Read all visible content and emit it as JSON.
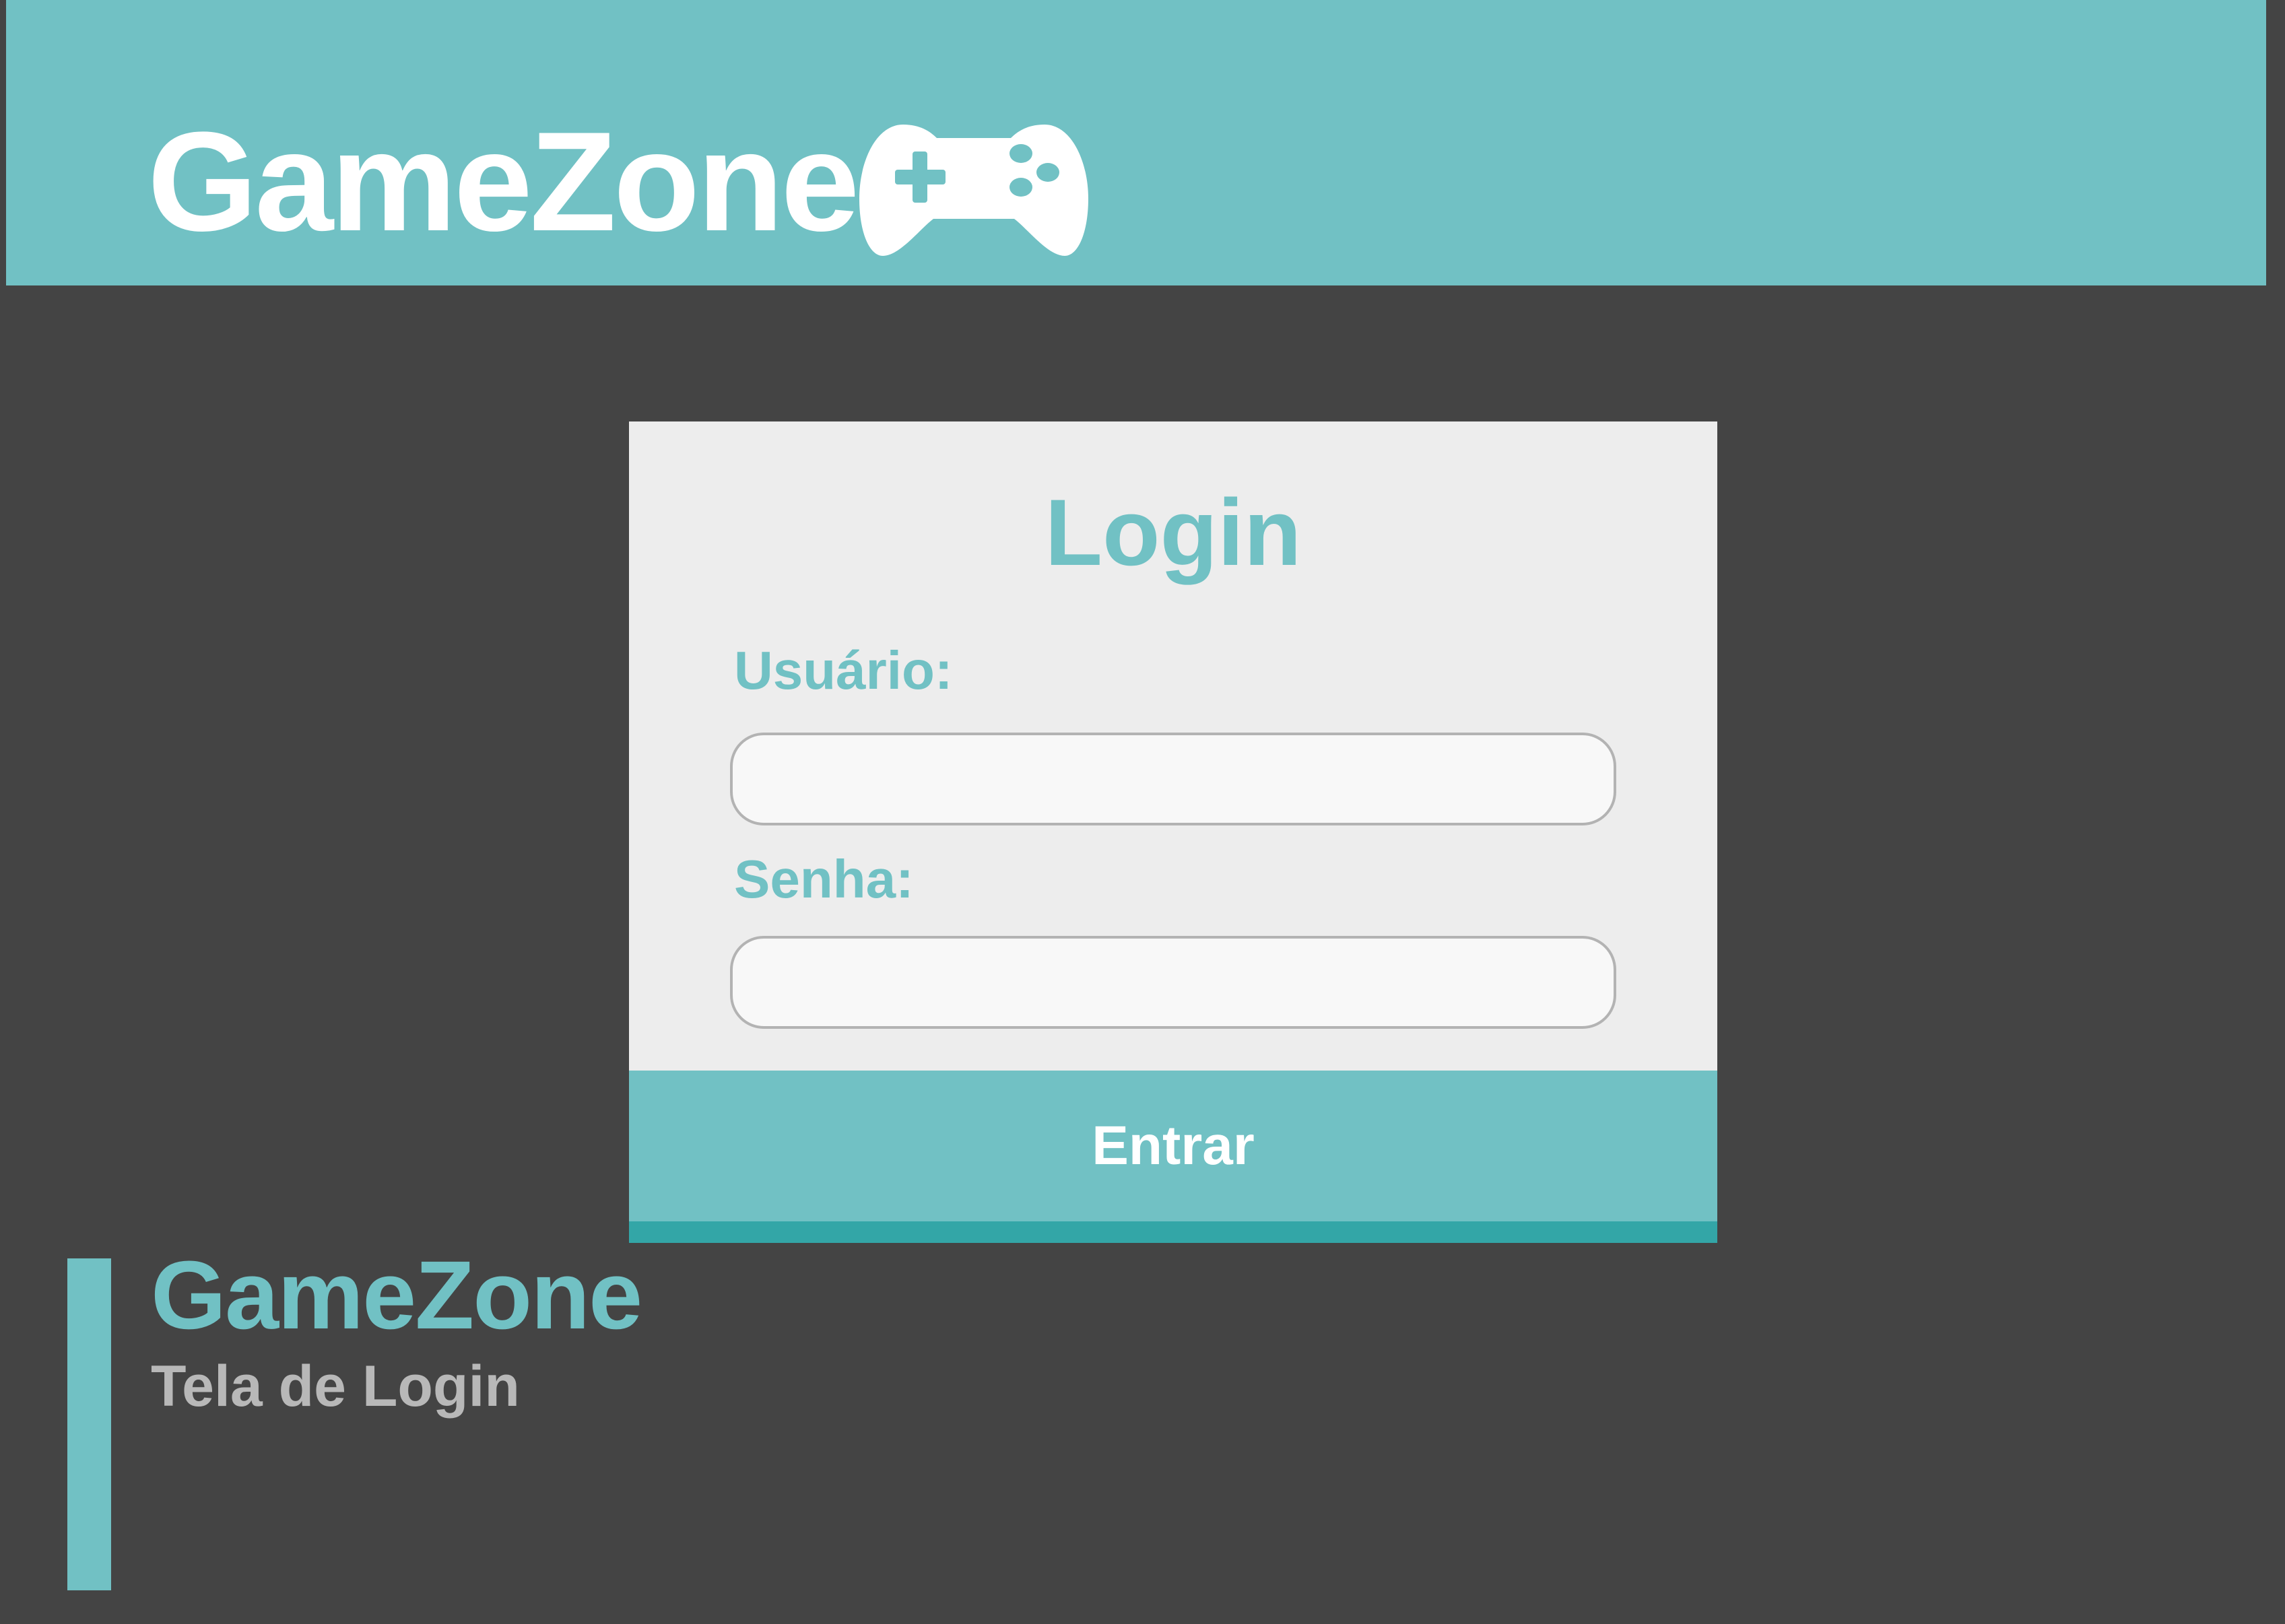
{
  "header": {
    "brand": "GameZone",
    "icon": "gamepad-icon"
  },
  "login": {
    "title": "Login",
    "username_label": "Usuário:",
    "username_value": "",
    "password_label": "Senha:",
    "password_value": "",
    "submit_label": "Entrar"
  },
  "caption": {
    "title": "GameZone",
    "subtitle": "Tela de Login"
  },
  "colors": {
    "background": "#444444",
    "accent": "#71c1c4",
    "accent_dark": "#33a6a7",
    "card": "#ededed",
    "caption_subtitle": "#b8b8b8"
  }
}
